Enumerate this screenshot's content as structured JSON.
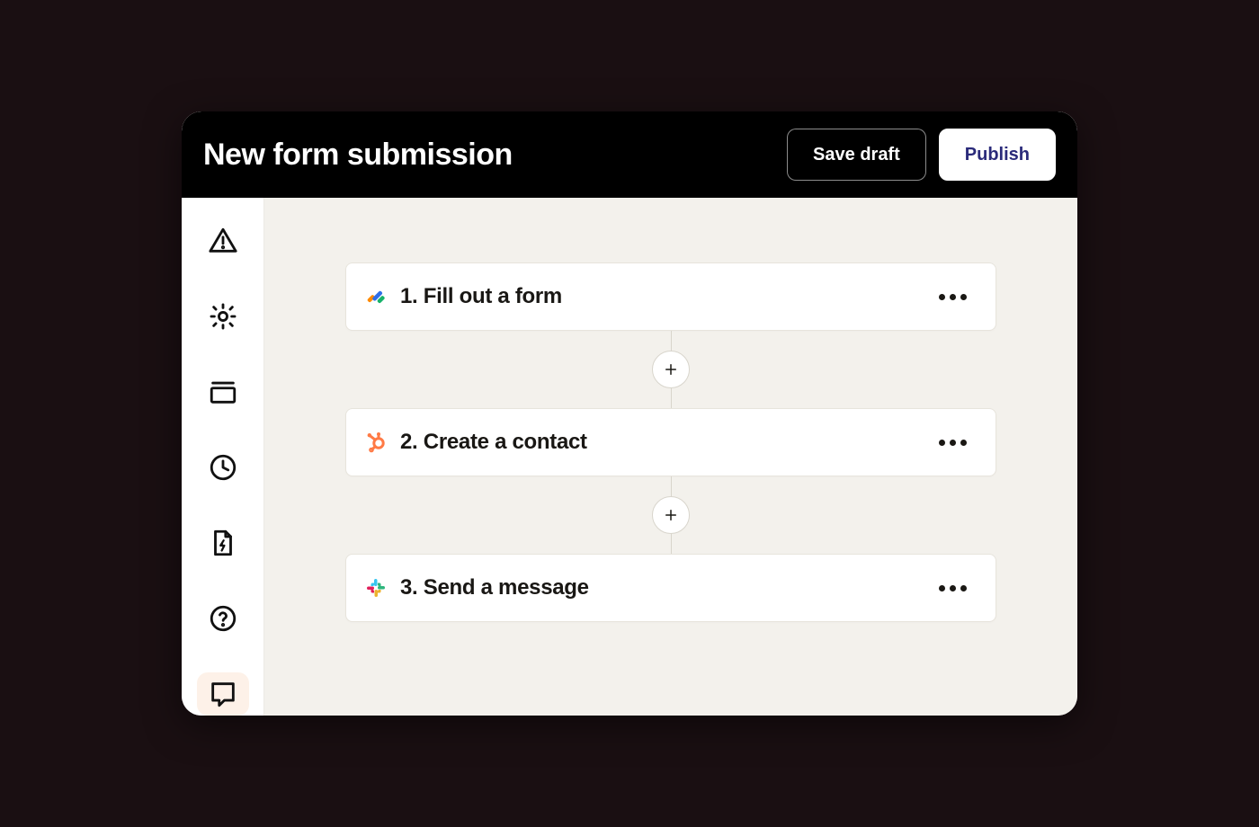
{
  "header": {
    "title": "New form submission",
    "save_draft_label": "Save draft",
    "publish_label": "Publish"
  },
  "sidebar": {
    "items": [
      {
        "id": "alerts",
        "icon": "alert-triangle-icon"
      },
      {
        "id": "settings",
        "icon": "gear-icon"
      },
      {
        "id": "stack",
        "icon": "stack-icon"
      },
      {
        "id": "history",
        "icon": "clock-icon"
      },
      {
        "id": "power",
        "icon": "file-bolt-icon"
      },
      {
        "id": "help",
        "icon": "help-circle-icon"
      },
      {
        "id": "chat",
        "icon": "chat-icon",
        "active": true
      }
    ]
  },
  "workflow": {
    "steps": [
      {
        "number": "1.",
        "title": "Fill out a form",
        "app": "jotform"
      },
      {
        "number": "2.",
        "title": "Create a contact",
        "app": "hubspot"
      },
      {
        "number": "3.",
        "title": "Send a message",
        "app": "slack"
      }
    ],
    "add_step_tooltip": "+"
  }
}
